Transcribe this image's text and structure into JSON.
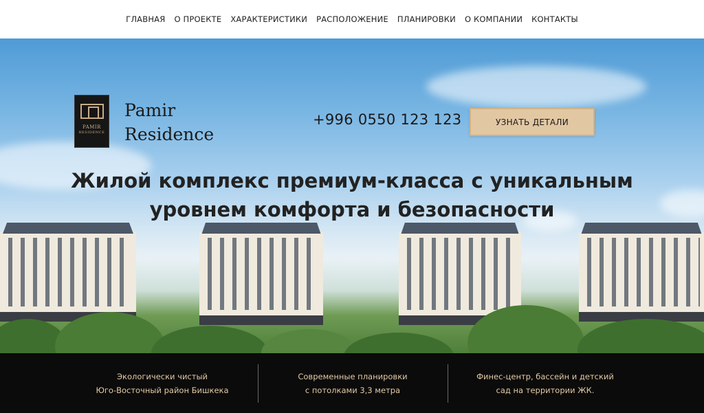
{
  "nav": {
    "items": [
      {
        "label": "ГЛАВНАЯ"
      },
      {
        "label": "О ПРОЕКТЕ"
      },
      {
        "label": "ХАРАКТЕРИСТИКИ"
      },
      {
        "label": "РАСПОЛОЖЕНИЕ"
      },
      {
        "label": "ПЛАНИРОВКИ"
      },
      {
        "label": "О КОМПАНИИ"
      },
      {
        "label": "КОНТАКТЫ"
      }
    ]
  },
  "logo": {
    "line1": "PAMIR",
    "line2": "RESIDENCE"
  },
  "brand": {
    "line1": "Pamir",
    "line2": "Residence"
  },
  "header": {
    "phone": "+996 0550 123 123",
    "cta_label": "УЗНАТЬ ДЕТАЛИ"
  },
  "hero": {
    "headline_line1": "Жилой комплекс премиум-класса с уникальным",
    "headline_line2": "уровнем комфорта и безопасности"
  },
  "features": [
    {
      "line1": "Экологически чистый",
      "line2": "Юго-Восточный район Бишкека"
    },
    {
      "line1": "Современные планировки",
      "line2": "с потолками 3,3 метра"
    },
    {
      "line1": "Финес-центр, бассейн и детский",
      "line2": "сад на территории ЖК."
    }
  ],
  "colors": {
    "accent_gold": "#e2c7a3",
    "footer_bg": "#0b0b0b",
    "footer_text": "#e3c9a5"
  }
}
